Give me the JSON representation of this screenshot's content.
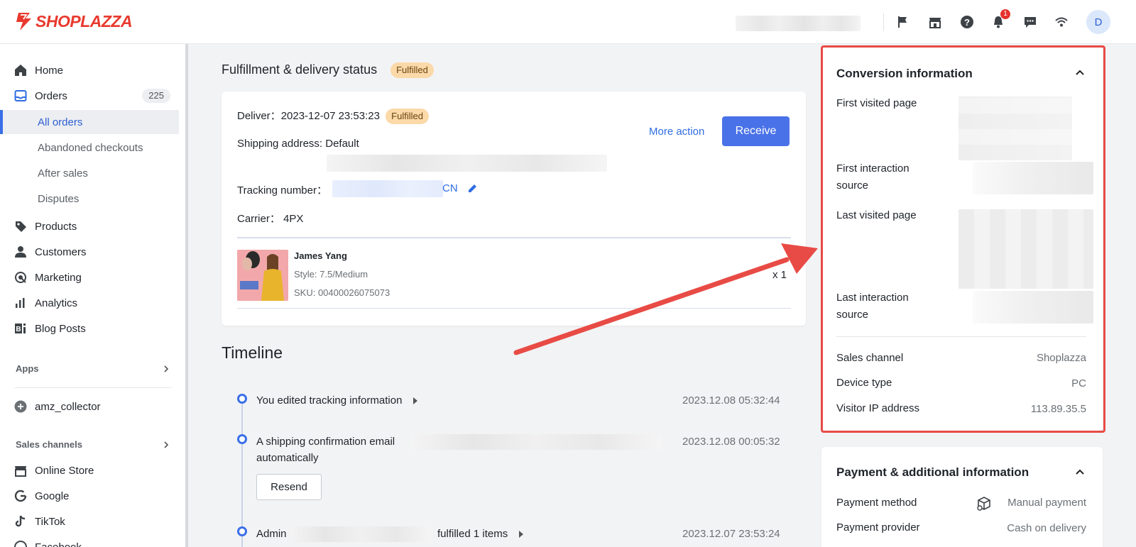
{
  "header": {
    "logo_text": "SHOPLAZZA",
    "icons": [
      "flag-icon",
      "store-icon",
      "help-icon",
      "bell-icon",
      "chat-icon",
      "wifi-icon"
    ],
    "notification_count": "1",
    "avatar_initial": "D"
  },
  "sidebar": {
    "items": [
      {
        "label": "Home",
        "icon": "home-icon"
      },
      {
        "label": "Orders",
        "icon": "orders-icon",
        "badge": "225"
      },
      {
        "label": "Products",
        "icon": "tag-icon"
      },
      {
        "label": "Customers",
        "icon": "person-icon"
      },
      {
        "label": "Marketing",
        "icon": "marketing-icon"
      },
      {
        "label": "Analytics",
        "icon": "analytics-icon"
      },
      {
        "label": "Blog Posts",
        "icon": "blog-icon"
      }
    ],
    "order_subitems": [
      "All orders",
      "Abandoned checkouts",
      "After sales",
      "Disputes"
    ],
    "apps_label": "Apps",
    "app_item": "amz_collector",
    "sales_channels_label": "Sales channels",
    "channels": [
      "Online Store",
      "Google",
      "TikTok",
      "Facebook"
    ]
  },
  "fulfillment": {
    "title": "Fulfillment & delivery status",
    "status_tag": "Fulfilled",
    "deliver_label": "Deliver：",
    "deliver_time": "2023-12-07 23:53:23",
    "deliver_tag": "Fulfilled",
    "shipping_address": "Shipping address: Default",
    "tracking_label": "Tracking number：",
    "tracking_suffix": "CN",
    "carrier": "Carrier：  4PX",
    "more_action": "More action",
    "receive": "Receive",
    "product": {
      "name": "James Yang",
      "style": "Style: 7.5/Medium",
      "sku": "SKU: 00400026075073",
      "qty": "x 1"
    }
  },
  "timeline": {
    "title": "Timeline",
    "events": [
      {
        "text": "You edited tracking information",
        "time": "2023.12.08 05:32:44"
      },
      {
        "text": "A shipping confirmation email",
        "text2": "automatically",
        "time": "2023.12.08 00:05:32",
        "button": "Resend"
      },
      {
        "text": "Admin",
        "text_after": "fulfilled 1 items",
        "time": "2023.12.07 23:53:24"
      }
    ]
  },
  "conversion": {
    "title": "Conversion information",
    "first_visited_page": "First visited page",
    "first_interaction_source_1": "First interaction",
    "first_interaction_source_2": "source",
    "last_visited_page": "Last visited page",
    "last_interaction_source_1": "Last interaction",
    "last_interaction_source_2": "source",
    "sales_channel_label": "Sales channel",
    "sales_channel_value": "Shoplazza",
    "device_type_label": "Device type",
    "device_type_value": "PC",
    "visitor_ip_label": "Visitor IP address",
    "visitor_ip_value": "113.89.35.5"
  },
  "payment": {
    "title": "Payment & additional information",
    "method_label": "Payment method",
    "method_value": "Manual payment",
    "provider_label": "Payment provider",
    "provider_value": "Cash on delivery"
  },
  "colors": {
    "accent": "#4a72e8",
    "highlight": "#e84b45",
    "fulfilled_tag": "#fbd9a8",
    "brand": "#e83a2f"
  }
}
